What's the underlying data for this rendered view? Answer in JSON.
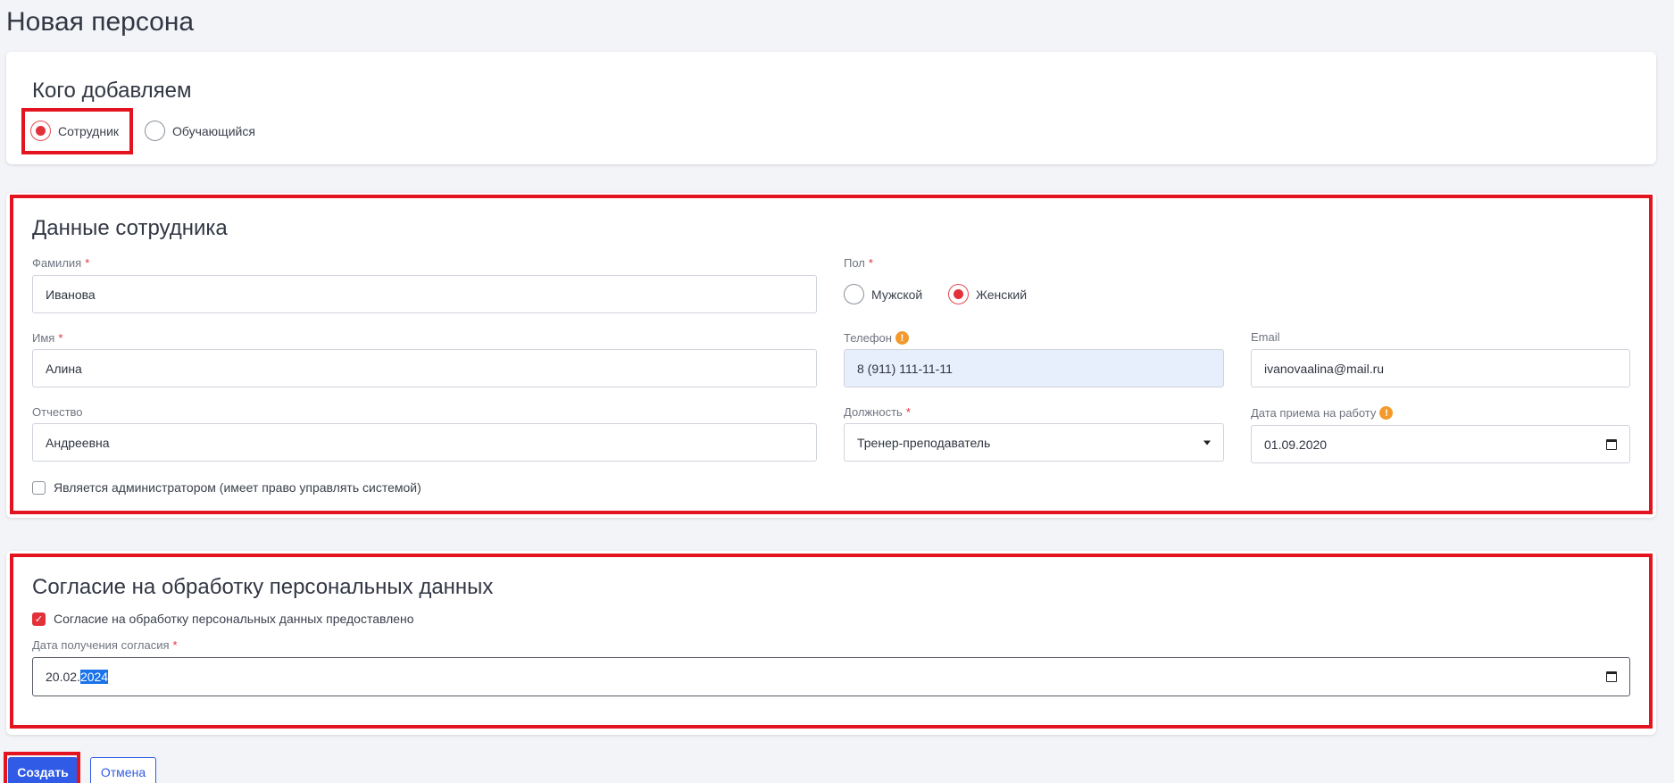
{
  "page": {
    "title": "Новая персона"
  },
  "who_section": {
    "title": "Кого добавляем",
    "options": [
      {
        "label": "Сотрудник",
        "selected": true
      },
      {
        "label": "Обучающийся",
        "selected": false
      }
    ]
  },
  "employee_section": {
    "title": "Данные сотрудника",
    "last_name": {
      "label": "Фамилия",
      "required": "*",
      "value": "Иванова"
    },
    "first_name": {
      "label": "Имя",
      "required": "*",
      "value": "Алина"
    },
    "patronymic": {
      "label": "Отчество",
      "value": "Андреевна"
    },
    "gender": {
      "label": "Пол",
      "required": "*",
      "options": [
        {
          "label": "Мужской",
          "selected": false
        },
        {
          "label": "Женский",
          "selected": true
        }
      ]
    },
    "phone": {
      "label": "Телефон",
      "value": "8 (911) 111-11-11",
      "warning_icon": "!"
    },
    "email": {
      "label": "Email",
      "value": "ivanovaalina@mail.ru"
    },
    "position": {
      "label": "Должность",
      "required": "*",
      "value": "Тренер-преподаватель"
    },
    "hire_date": {
      "label": "Дата приема на работу",
      "value": "01.09.2020",
      "warning_icon": "!"
    },
    "is_admin": {
      "label": "Является администратором (имеет право управлять системой)",
      "checked": false
    }
  },
  "consent_section": {
    "title": "Согласие на обработку персональных данных",
    "consent_checkbox": {
      "label": "Согласие на обработку персональных данных предоставлено",
      "checked": true,
      "check_mark": "✓"
    },
    "consent_date": {
      "label": "Дата получения согласия",
      "required": "*",
      "value_prefix": "20.02.",
      "value_selected": "2024"
    }
  },
  "actions": {
    "create_label": "Создать",
    "cancel_label": "Отмена"
  },
  "colors": {
    "highlight": "#e3141f",
    "accent": "#e3313a",
    "primary": "#2f5be6",
    "warning": "#f39a2d"
  }
}
